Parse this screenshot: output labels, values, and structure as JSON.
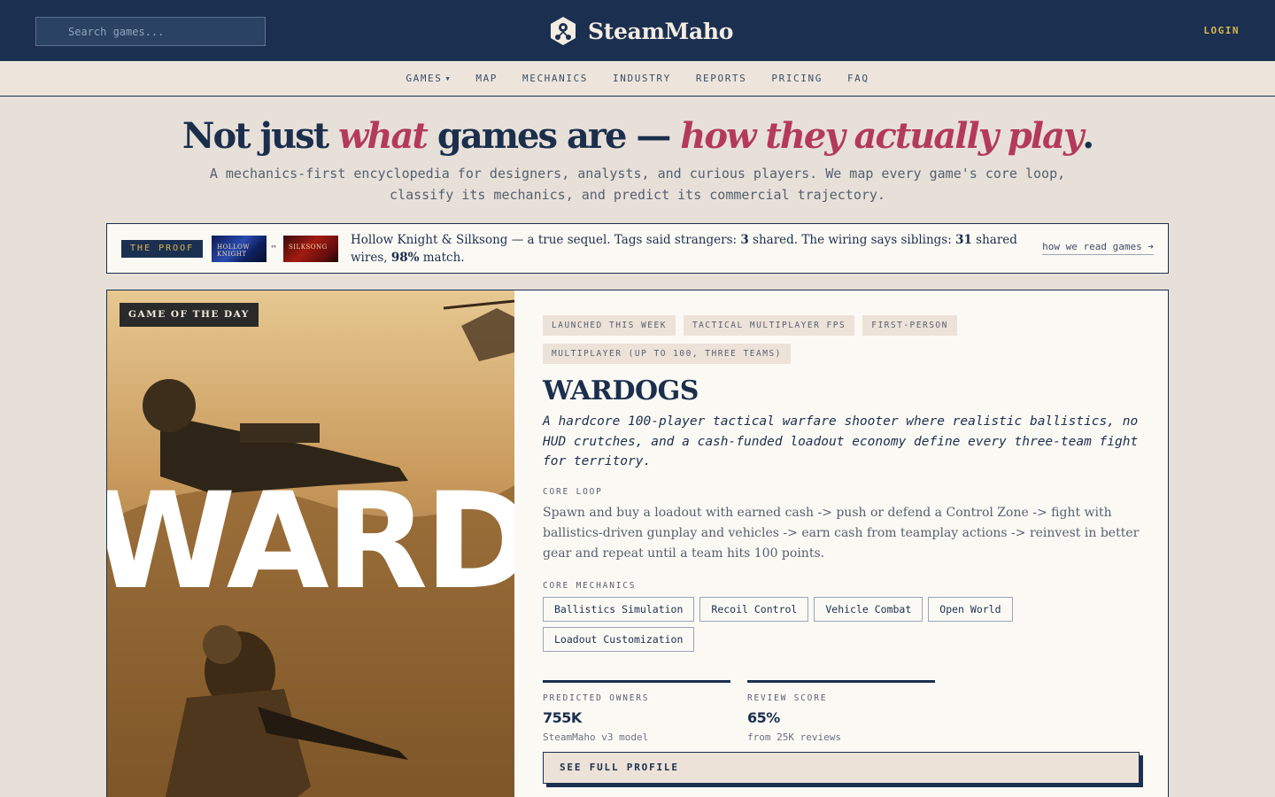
{
  "header": {
    "search_placeholder": "Search games...",
    "brand": "SteamMaho",
    "login": "LOGIN"
  },
  "nav": {
    "items": [
      "GAMES",
      "MAP",
      "MECHANICS",
      "INDUSTRY",
      "REPORTS",
      "PRICING",
      "FAQ"
    ]
  },
  "hero": {
    "title_1": "Not just ",
    "title_em_1": "what",
    "title_2": " games are — ",
    "title_em_2": "how they actually play",
    "title_3": ".",
    "subtitle": "A mechanics-first encyclopedia for designers, analysts, and curious players. We map every game's core loop, classify its mechanics, and predict its commercial trajectory."
  },
  "proof": {
    "label": "THE PROOF",
    "thumb_1": "HOLLOW KNIGHT",
    "thumb_2": "SILKSONG",
    "link_symbol": "⇔",
    "text_1": "Hollow Knight & Silksong — a true sequel. Tags said strangers: ",
    "tags_shared": "3",
    "text_2": " shared. The wiring says siblings: ",
    "wires_shared": "31",
    "text_3": " shared wires, ",
    "match_pct": "98%",
    "text_4": " match.",
    "more": "how we read games ➔"
  },
  "feature": {
    "badge": "GAME OF THE DAY",
    "image_text": "WARDO",
    "tags": [
      "LAUNCHED THIS WEEK",
      "TACTICAL MULTIPLAYER FPS",
      "FIRST-PERSON",
      "MULTIPLAYER (UP TO 100, THREE TEAMS)"
    ],
    "title": "WARDOGS",
    "description": "A hardcore 100-player tactical warfare shooter where realistic ballistics, no HUD crutches, and a cash-funded loadout economy define every three-team fight for territory.",
    "core_loop_label": "CORE LOOP",
    "core_loop": "Spawn and buy a loadout with earned cash -> push or defend a Control Zone -> fight with ballistics-driven gunplay and vehicles -> earn cash from teamplay actions -> reinvest in better gear and repeat until a team hits 100 points.",
    "mechanics_label": "CORE MECHANICS",
    "mechanics": [
      "Ballistics Simulation",
      "Recoil Control",
      "Vehicle Combat",
      "Open World",
      "Loadout Customization"
    ],
    "stats": [
      {
        "label": "PREDICTED OWNERS",
        "value": "755K",
        "note": "SteamMaho v3 model"
      },
      {
        "label": "REVIEW SCORE",
        "value": "65%",
        "note": "from 25K reviews"
      }
    ],
    "cta": "SEE FULL PROFILE"
  },
  "colors": {
    "navy": "#1b3050",
    "accent_rose": "#b43a5a",
    "gold": "#d8b551",
    "paper": "#fbf9f4"
  }
}
